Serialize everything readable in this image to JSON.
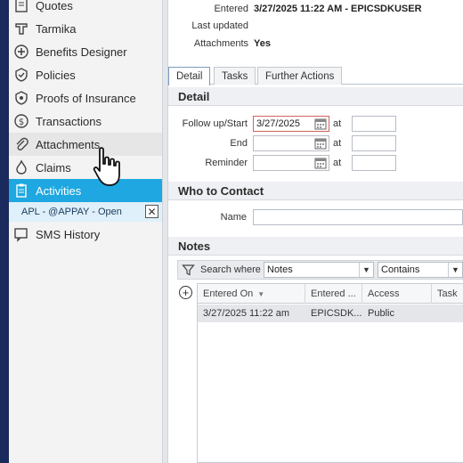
{
  "sidebar": {
    "items": [
      {
        "label": "Quotes",
        "icon": "quotes-icon"
      },
      {
        "label": "Tarmika",
        "icon": "tarmika-icon"
      },
      {
        "label": "Benefits Designer",
        "icon": "benefits-designer-icon"
      },
      {
        "label": "Policies",
        "icon": "policies-icon"
      },
      {
        "label": "Proofs of Insurance",
        "icon": "proofs-of-insurance-icon"
      },
      {
        "label": "Transactions",
        "icon": "transactions-icon"
      },
      {
        "label": "Attachments",
        "icon": "paperclip-icon"
      },
      {
        "label": "Claims",
        "icon": "claims-icon"
      },
      {
        "label": "Activities",
        "icon": "clipboard-icon"
      },
      {
        "label": "SMS History",
        "icon": "sms-history-icon"
      }
    ],
    "open_activity": {
      "label": "APL - @APPAY - Open",
      "close_glyph": "✕"
    },
    "active_color": "#1ea7e0"
  },
  "header": {
    "entered_label": "Entered",
    "entered_value": "3/27/2025 11:22 AM - EPICSDKUSER",
    "last_updated_label": "Last updated",
    "last_updated_value": "",
    "attachments_label": "Attachments",
    "attachments_value": "Yes"
  },
  "tabs": [
    {
      "label": "Detail",
      "active": true
    },
    {
      "label": "Tasks",
      "active": false
    },
    {
      "label": "Further Actions",
      "active": false
    }
  ],
  "detail": {
    "title": "Detail",
    "follow_up_label": "Follow up/Start",
    "follow_up_value": "3/27/2025",
    "end_label": "End",
    "end_value": "",
    "reminder_label": "Reminder",
    "reminder_value": "",
    "at_label": "at"
  },
  "who_to_contact": {
    "title": "Who to Contact",
    "name_label": "Name",
    "name_value": ""
  },
  "notes": {
    "title": "Notes",
    "search_where_label": "Search where",
    "field_select": "Notes",
    "operator_select": "Contains",
    "add_glyph": "+",
    "columns": [
      "Entered On",
      "Entered ...",
      "Access",
      "Task"
    ],
    "rows": [
      {
        "entered_on": "3/27/2025 11:22 am",
        "entered_by": "EPICSDK...",
        "access": "Public",
        "task": ""
      }
    ]
  }
}
